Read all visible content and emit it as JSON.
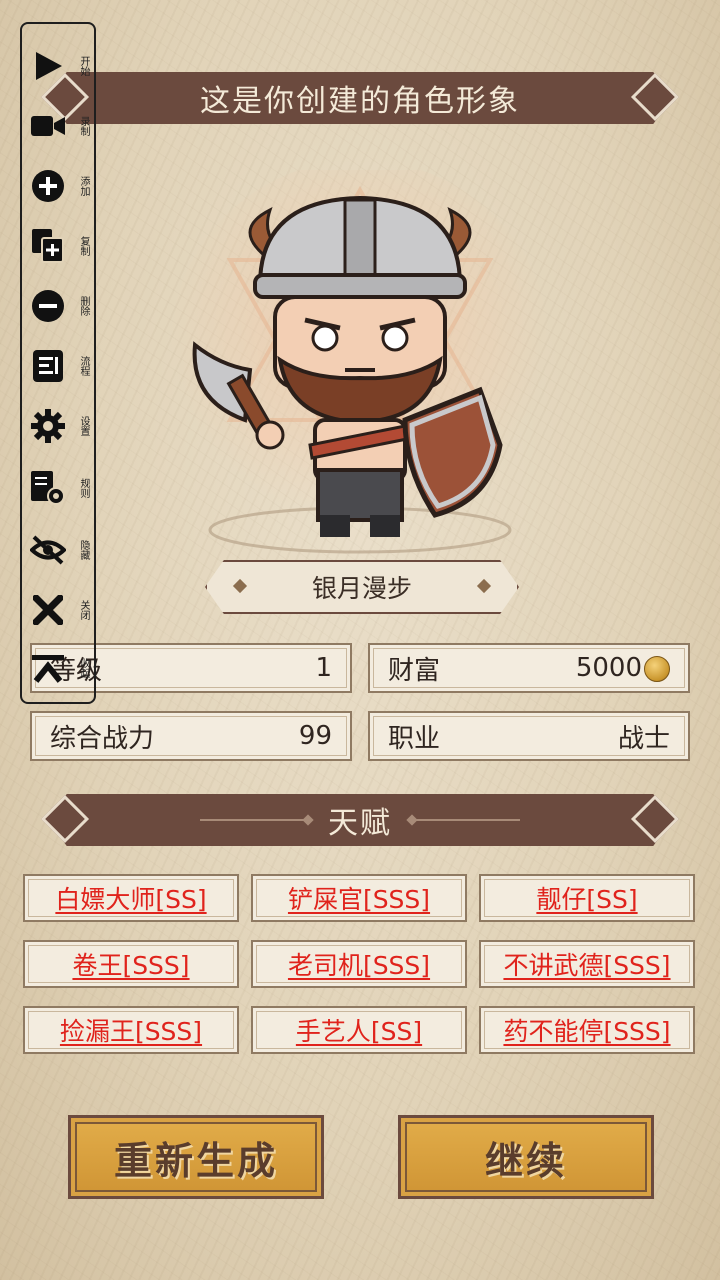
{
  "header": {
    "title": "这是你创建的角色形象"
  },
  "character": {
    "name": "银月漫步"
  },
  "stats": {
    "level_label": "等级",
    "level_value": "1",
    "wealth_label": "财富",
    "wealth_value": "5000",
    "power_label": "综合战力",
    "power_value": "99",
    "class_label": "职业",
    "class_value": "战士"
  },
  "talents": {
    "title": "天赋",
    "items": [
      "白嫖大师[SS]",
      "铲屎官[SSS]",
      "靓仔[SS]",
      "卷王[SSS]",
      "老司机[SSS]",
      "不讲武德[SSS]",
      "捡漏王[SSS]",
      "手艺人[SS]",
      "药不能停[SSS]"
    ]
  },
  "buttons": {
    "regenerate": "重新生成",
    "continue": "继续"
  },
  "toolbar": {
    "items": [
      {
        "label": "开始",
        "icon": "play-icon"
      },
      {
        "label": "录制",
        "icon": "video-camera-icon"
      },
      {
        "label": "添加",
        "icon": "plus-circle-icon"
      },
      {
        "label": "复制",
        "icon": "copy-icon"
      },
      {
        "label": "删除",
        "icon": "minus-circle-icon"
      },
      {
        "label": "流程",
        "icon": "flow-list-icon"
      },
      {
        "label": "设置",
        "icon": "gear-icon"
      },
      {
        "label": "规则",
        "icon": "rules-icon"
      },
      {
        "label": "隐藏",
        "icon": "eye-off-icon"
      },
      {
        "label": "关闭",
        "icon": "close-icon"
      },
      {
        "label": "收起",
        "icon": "collapse-icon"
      }
    ]
  },
  "colors": {
    "banner": "#6b4a3e",
    "talent_text": "#e0231c",
    "button": "#d9a244"
  }
}
